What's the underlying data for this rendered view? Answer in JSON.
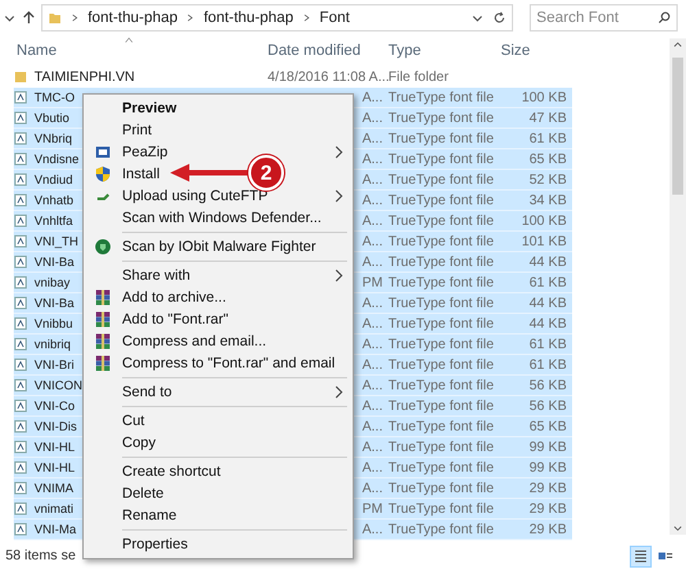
{
  "address_bar": {
    "crumbs": [
      "font-thu-phap",
      "font-thu-phap",
      "Font"
    ]
  },
  "search": {
    "placeholder": "Search Font"
  },
  "columns": [
    "Name",
    "Date modified",
    "Type",
    "Size"
  ],
  "rows": [
    {
      "kind": "folder",
      "name": "TAIMIENPHI.VN",
      "date": "4/18/2016 11:08 A...",
      "type": "File folder",
      "size": "",
      "selected": false
    },
    {
      "kind": "file",
      "name": "TMC-O",
      "date": "A...",
      "type": "TrueType font file",
      "size": "100 KB",
      "selected": true
    },
    {
      "kind": "file",
      "name": "Vbutio",
      "date": "A...",
      "type": "TrueType font file",
      "size": "47 KB",
      "selected": true
    },
    {
      "kind": "file",
      "name": "VNbriq",
      "date": "A...",
      "type": "TrueType font file",
      "size": "61 KB",
      "selected": true
    },
    {
      "kind": "file",
      "name": "Vndisne",
      "date": "A...",
      "type": "TrueType font file",
      "size": "65 KB",
      "selected": true
    },
    {
      "kind": "file",
      "name": "Vndiud",
      "date": "A...",
      "type": "TrueType font file",
      "size": "52 KB",
      "selected": true
    },
    {
      "kind": "file",
      "name": "Vnhatb",
      "date": "A...",
      "type": "TrueType font file",
      "size": "34 KB",
      "selected": true
    },
    {
      "kind": "file",
      "name": "Vnhltfa",
      "date": "A...",
      "type": "TrueType font file",
      "size": "100 KB",
      "selected": true
    },
    {
      "kind": "file",
      "name": "VNI_TH",
      "date": "A...",
      "type": "TrueType font file",
      "size": "101 KB",
      "selected": true
    },
    {
      "kind": "file",
      "name": "VNI-Ba",
      "date": "A...",
      "type": "TrueType font file",
      "size": "44 KB",
      "selected": true
    },
    {
      "kind": "file",
      "name": "vnibay",
      "date": "PM",
      "type": "TrueType font file",
      "size": "61 KB",
      "selected": true
    },
    {
      "kind": "file",
      "name": "VNI-Ba",
      "date": "A...",
      "type": "TrueType font file",
      "size": "44 KB",
      "selected": true
    },
    {
      "kind": "file",
      "name": "Vnibbu",
      "date": "A...",
      "type": "TrueType font file",
      "size": "44 KB",
      "selected": true
    },
    {
      "kind": "file",
      "name": "vnibriq",
      "date": "A...",
      "type": "TrueType font file",
      "size": "61 KB",
      "selected": true
    },
    {
      "kind": "file",
      "name": "VNI-Bri",
      "date": "A...",
      "type": "TrueType font file",
      "size": "61 KB",
      "selected": true
    },
    {
      "kind": "file",
      "name": "VNICON",
      "date": "A...",
      "type": "TrueType font file",
      "size": "56 KB",
      "selected": true
    },
    {
      "kind": "file",
      "name": "VNI-Co",
      "date": "A...",
      "type": "TrueType font file",
      "size": "56 KB",
      "selected": true
    },
    {
      "kind": "file",
      "name": "VNI-Dis",
      "date": "A...",
      "type": "TrueType font file",
      "size": "65 KB",
      "selected": true
    },
    {
      "kind": "file",
      "name": "VNI-HL",
      "date": "A...",
      "type": "TrueType font file",
      "size": "99 KB",
      "selected": true
    },
    {
      "kind": "file",
      "name": "VNI-HL",
      "date": "A...",
      "type": "TrueType font file",
      "size": "99 KB",
      "selected": true
    },
    {
      "kind": "file",
      "name": "VNIMA",
      "date": "A...",
      "type": "TrueType font file",
      "size": "29 KB",
      "selected": true
    },
    {
      "kind": "file",
      "name": "vnimati",
      "date": "PM",
      "type": "TrueType font file",
      "size": "29 KB",
      "selected": true
    },
    {
      "kind": "file",
      "name": "VNI-Ma",
      "date": "A...",
      "type": "TrueType font file",
      "size": "29 KB",
      "selected": true
    }
  ],
  "context_menu": [
    {
      "kind": "item",
      "label": "Preview",
      "default": true,
      "submenu": false
    },
    {
      "kind": "item",
      "label": "Print",
      "default": false,
      "submenu": false
    },
    {
      "kind": "item",
      "label": "PeaZip",
      "default": false,
      "submenu": true
    },
    {
      "kind": "item",
      "label": "Install",
      "default": false,
      "submenu": false
    },
    {
      "kind": "item",
      "label": "Upload using CuteFTP",
      "default": false,
      "submenu": true
    },
    {
      "kind": "item",
      "label": "Scan with Windows Defender...",
      "default": false,
      "submenu": false
    },
    {
      "kind": "separator"
    },
    {
      "kind": "item",
      "label": "Scan by IObit Malware Fighter",
      "default": false,
      "submenu": false
    },
    {
      "kind": "separator"
    },
    {
      "kind": "item",
      "label": "Share with",
      "default": false,
      "submenu": true
    },
    {
      "kind": "item",
      "label": "Add to archive...",
      "default": false,
      "submenu": false
    },
    {
      "kind": "item",
      "label": "Add to \"Font.rar\"",
      "default": false,
      "submenu": false
    },
    {
      "kind": "item",
      "label": "Compress and email...",
      "default": false,
      "submenu": false
    },
    {
      "kind": "item",
      "label": "Compress to \"Font.rar\" and email",
      "default": false,
      "submenu": false
    },
    {
      "kind": "separator"
    },
    {
      "kind": "item",
      "label": "Send to",
      "default": false,
      "submenu": true
    },
    {
      "kind": "separator"
    },
    {
      "kind": "item",
      "label": "Cut",
      "default": false,
      "submenu": false
    },
    {
      "kind": "item",
      "label": "Copy",
      "default": false,
      "submenu": false
    },
    {
      "kind": "separator"
    },
    {
      "kind": "item",
      "label": "Create shortcut",
      "default": false,
      "submenu": false
    },
    {
      "kind": "item",
      "label": "Delete",
      "default": false,
      "submenu": false
    },
    {
      "kind": "item",
      "label": "Rename",
      "default": false,
      "submenu": false
    },
    {
      "kind": "separator"
    },
    {
      "kind": "item",
      "label": "Properties",
      "default": false,
      "submenu": false
    }
  ],
  "annotation": {
    "label": "2"
  },
  "status_bar": {
    "text": "58 items se"
  }
}
